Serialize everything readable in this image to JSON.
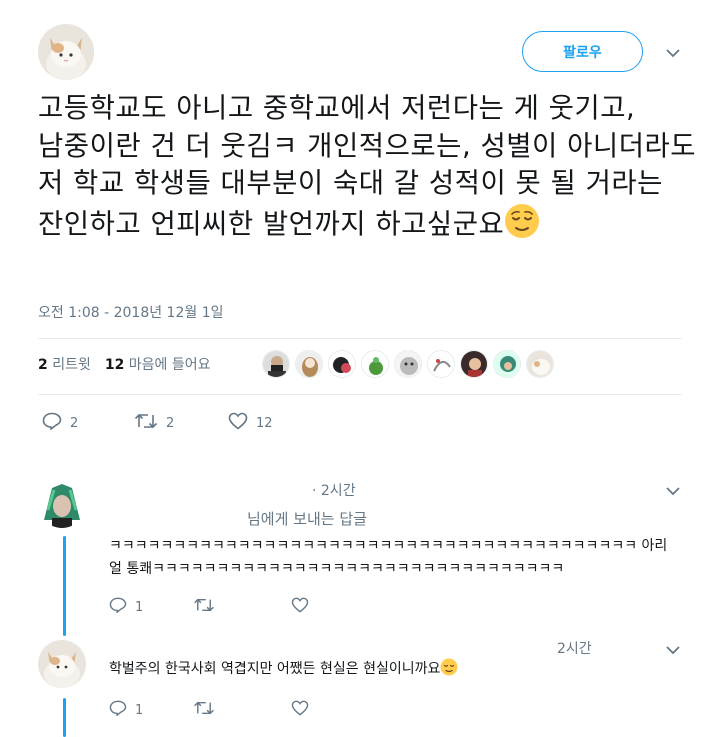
{
  "tweet": {
    "follow_label": "팔로우",
    "text": "고등학교도 아니고 중학교에서 저런다는 게 웃기고, 남중이란 건 더 웃김ㅋ 개인적으로는, 성별이 아니더라도 저 학교 학생들 대부분이  숙대 갈 성적이 못 될 거라는 잔인하고 언피씨한 발언까지 하고싶군요",
    "timestamp": "오전 1:08 - 2018년 12월 1일",
    "retweet_count": "2",
    "retweet_label": "리트윗",
    "like_count": "12",
    "like_label": "마음에 들어요",
    "actions": {
      "reply": "2",
      "retweet": "2",
      "like": "12"
    }
  },
  "replies": [
    {
      "time": "· 2시간",
      "reply_to": "님에게 보내는 답글",
      "text": "ㅋㅋㅋㅋㅋㅋㅋㅋㅋㅋㅋㅋㅋㅋㅋㅋㅋㅋㅋㅋㅋㅋㅋㅋㅋㅋㅋㅋㅋㅋㅋㅋㅋㅋㅋㅋㅋㅋㅋㅋㅋ 아리얼 통쾌ㅋㅋㅋㅋㅋㅋㅋㅋㅋㅋㅋㅋㅋㅋㅋㅋㅋㅋㅋㅋㅋㅋㅋㅋㅋㅋㅋㅋㅋㅋㅋㅋ",
      "reply_count": "1",
      "retweet_count": "",
      "like_count": ""
    },
    {
      "time": "2시간",
      "text": "학벌주의 한국사회 역겹지만 어쨌든 현실은 현실이니까요",
      "reply_count": "1",
      "retweet_count": "",
      "like_count": ""
    }
  ],
  "icons": {
    "chevron": "chevron-down-icon",
    "reply": "reply-icon",
    "retweet": "retweet-icon",
    "like": "heart-icon",
    "emoji": "relieved-face-emoji"
  },
  "colors": {
    "accent": "#1da1f2",
    "muted": "#657786",
    "text": "#14171a",
    "divider": "#e6ecf0"
  }
}
